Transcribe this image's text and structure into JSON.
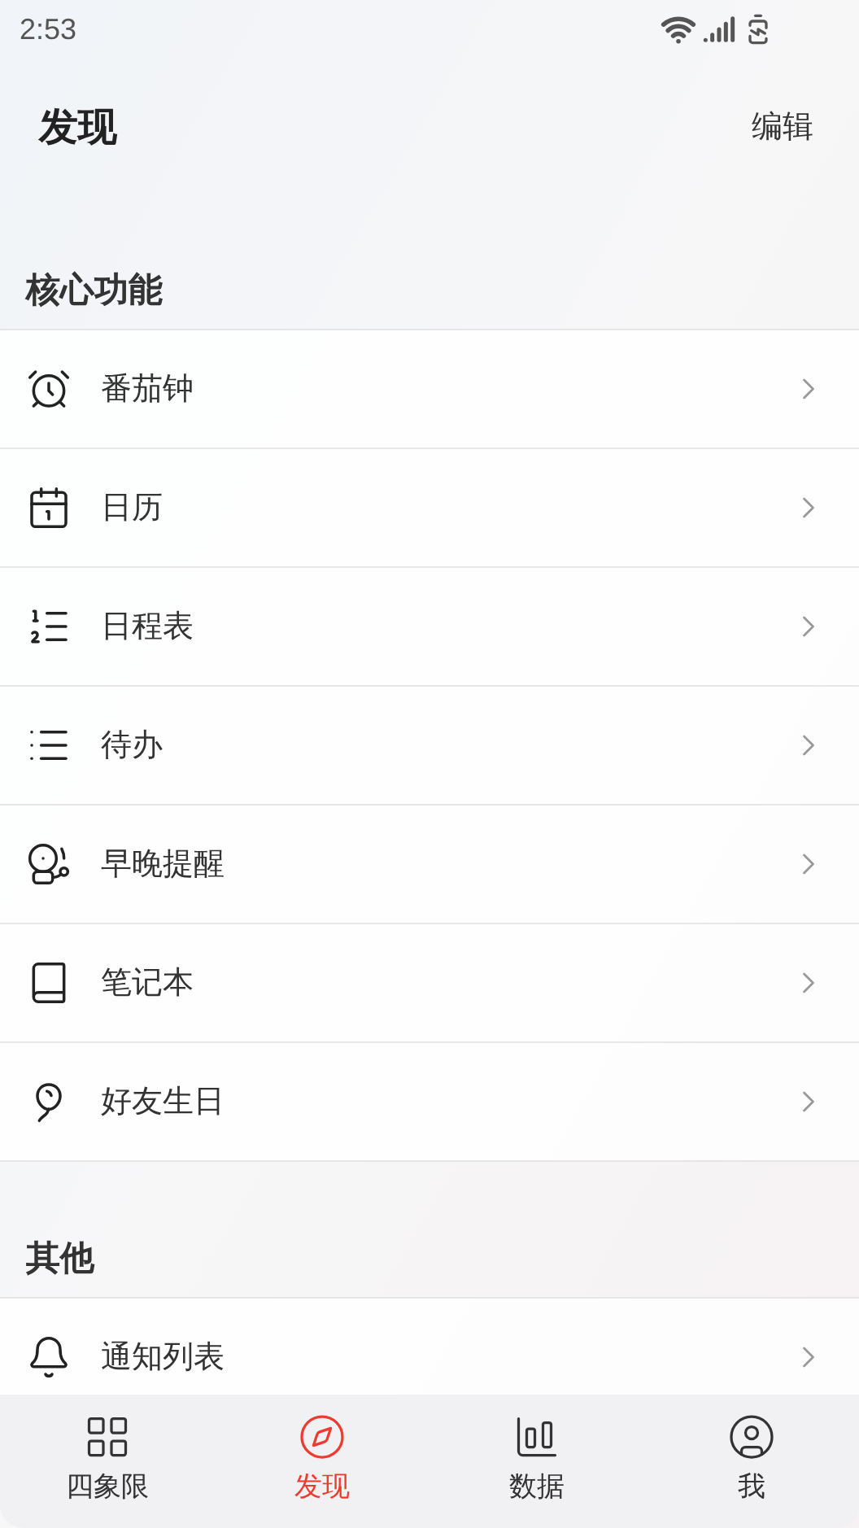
{
  "status_bar": {
    "time": "2:53"
  },
  "header": {
    "title": "发现",
    "action": "编辑"
  },
  "sections": [
    {
      "title": "核心功能",
      "items": [
        {
          "kind": "alarm",
          "label": "番茄钟"
        },
        {
          "kind": "calendar",
          "label": "日历"
        },
        {
          "kind": "numbered",
          "label": "日程表"
        },
        {
          "kind": "list",
          "label": "待办"
        },
        {
          "kind": "deskbell",
          "label": "早晚提醒"
        },
        {
          "kind": "book",
          "label": "笔记本"
        },
        {
          "kind": "balloon",
          "label": "好友生日"
        }
      ]
    },
    {
      "title": "其他",
      "items": [
        {
          "kind": "bell",
          "label": "通知列表"
        }
      ]
    }
  ],
  "bottom_nav": [
    {
      "kind": "grid",
      "label": "四象限",
      "selected": false
    },
    {
      "kind": "compass",
      "label": "发现",
      "selected": true
    },
    {
      "kind": "chart",
      "label": "数据",
      "selected": false
    },
    {
      "kind": "user",
      "label": "我",
      "selected": false
    }
  ]
}
